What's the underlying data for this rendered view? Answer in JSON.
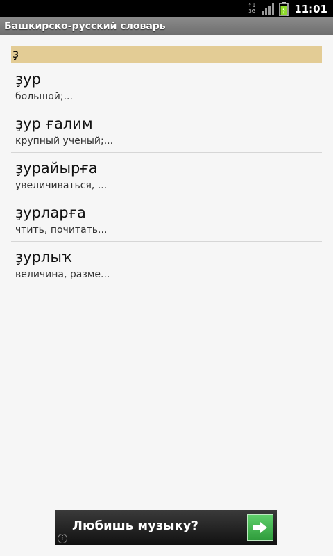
{
  "status_bar": {
    "network_label_top": "3G",
    "time": "11:01",
    "icons": [
      "network-3g-icon",
      "signal-icon",
      "battery-charging-icon"
    ]
  },
  "app": {
    "title": "Башкирско-русский словарь"
  },
  "search": {
    "value": "ҙ"
  },
  "results": [
    {
      "word": "ҙур",
      "translation": "большой;..."
    },
    {
      "word": "ҙур ғалим",
      "translation": "крупный ученый;..."
    },
    {
      "word": "ҙурайырға",
      "translation": "увеличиваться, ..."
    },
    {
      "word": "ҙурларға",
      "translation": "чтить, почитать..."
    },
    {
      "word": "ҙурлыҡ",
      "translation": "величина, разме..."
    }
  ],
  "ad": {
    "text": "Любишь музыку?",
    "info_glyph": "i",
    "arrow_icon": "arrow-right-icon"
  },
  "colors": {
    "search_bg": "#e3cc95",
    "ad_button": "#3fae4b"
  }
}
